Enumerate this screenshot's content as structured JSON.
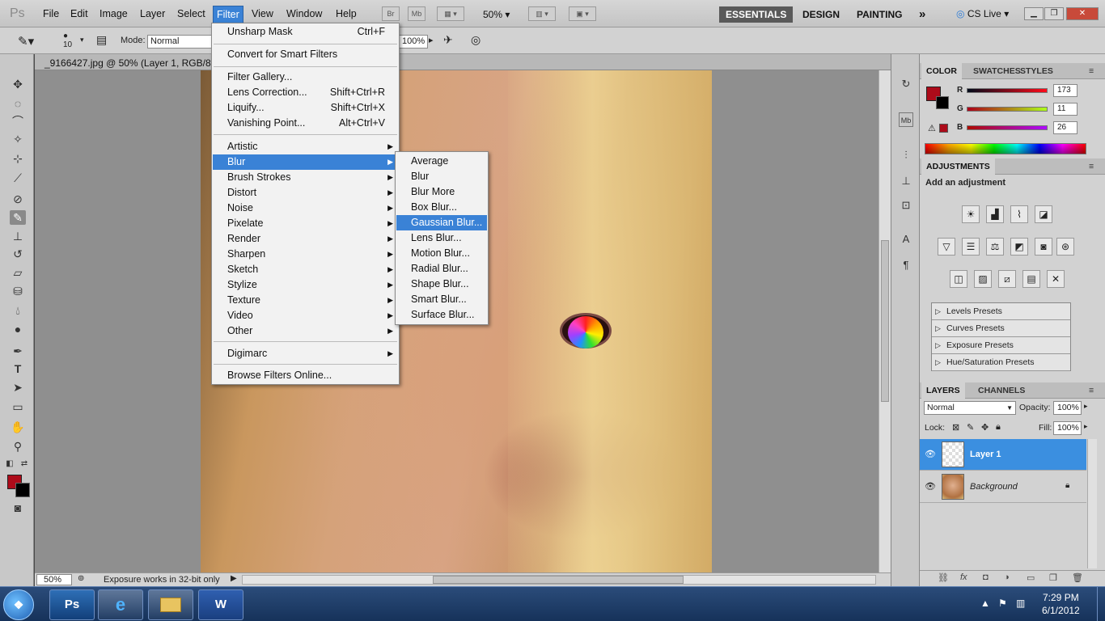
{
  "app": {
    "logo": "Ps",
    "menus": [
      "File",
      "Edit",
      "Image",
      "Layer",
      "Select",
      "Filter",
      "View",
      "Window",
      "Help"
    ],
    "active_menu": "Filter",
    "bridge_btn": "Br",
    "minibridge_btn": "Mb",
    "zoom": "50%",
    "workspaces": [
      "ESSENTIALS",
      "DESIGN",
      "PAINTING"
    ],
    "overflow": "»",
    "cs_live": "CS Live"
  },
  "options_bar": {
    "brush_size": "10",
    "mode_label": "Mode:",
    "mode_value": "Normal",
    "flow_value": "100%"
  },
  "document": {
    "tab_title": "_9166427.jpg @ 50% (Layer 1, RGB/8*) *"
  },
  "status": {
    "zoom": "50%",
    "message": "Exposure works in 32-bit only"
  },
  "filter_menu": {
    "items": [
      {
        "label": "Unsharp Mask",
        "shortcut": "Ctrl+F"
      },
      {
        "label": "Convert for Smart Filters",
        "shortcut": ""
      },
      {
        "label": "Filter Gallery...",
        "shortcut": ""
      },
      {
        "label": "Lens Correction...",
        "shortcut": "Shift+Ctrl+R"
      },
      {
        "label": "Liquify...",
        "shortcut": "Shift+Ctrl+X"
      },
      {
        "label": "Vanishing Point...",
        "shortcut": "Alt+Ctrl+V"
      },
      {
        "label": "Artistic",
        "shortcut": ""
      },
      {
        "label": "Blur",
        "shortcut": ""
      },
      {
        "label": "Brush Strokes",
        "shortcut": ""
      },
      {
        "label": "Distort",
        "shortcut": ""
      },
      {
        "label": "Noise",
        "shortcut": ""
      },
      {
        "label": "Pixelate",
        "shortcut": ""
      },
      {
        "label": "Render",
        "shortcut": ""
      },
      {
        "label": "Sharpen",
        "shortcut": ""
      },
      {
        "label": "Sketch",
        "shortcut": ""
      },
      {
        "label": "Stylize",
        "shortcut": ""
      },
      {
        "label": "Texture",
        "shortcut": ""
      },
      {
        "label": "Video",
        "shortcut": ""
      },
      {
        "label": "Other",
        "shortcut": ""
      },
      {
        "label": "Digimarc",
        "shortcut": ""
      },
      {
        "label": "Browse Filters Online...",
        "shortcut": ""
      }
    ],
    "highlighted": "Blur"
  },
  "blur_submenu": {
    "items": [
      "Average",
      "Blur",
      "Blur More",
      "Box Blur...",
      "Gaussian Blur...",
      "Lens Blur...",
      "Motion Blur...",
      "Radial Blur...",
      "Shape Blur...",
      "Smart Blur...",
      "Surface Blur..."
    ],
    "highlighted": "Gaussian Blur..."
  },
  "color_panel": {
    "tabs": [
      "COLOR",
      "SWATCHES",
      "STYLES"
    ],
    "channels": [
      {
        "label": "R",
        "value": "173"
      },
      {
        "label": "G",
        "value": "11"
      },
      {
        "label": "B",
        "value": "26"
      }
    ],
    "foreground": "#ad0b1a"
  },
  "adjustments_panel": {
    "tab": "ADJUSTMENTS",
    "heading": "Add an adjustment",
    "presets": [
      "Levels Presets",
      "Curves Presets",
      "Exposure Presets",
      "Hue/Saturation Presets"
    ]
  },
  "layers_panel": {
    "tabs": [
      "LAYERS",
      "CHANNELS"
    ],
    "blend_mode": "Normal",
    "opacity_label": "Opacity:",
    "opacity": "100%",
    "lock_label": "Lock:",
    "fill_label": "Fill:",
    "fill": "100%",
    "layers": [
      {
        "name": "Layer 1",
        "selected": true
      },
      {
        "name": "Background",
        "selected": false
      }
    ]
  },
  "taskbar": {
    "time": "7:29 PM",
    "date": "6/1/2012",
    "apps": [
      "Ps",
      "e",
      "W"
    ]
  },
  "colors": {
    "highlight": "#3a82d6",
    "foreground_swatch": "#ad0b1a"
  }
}
